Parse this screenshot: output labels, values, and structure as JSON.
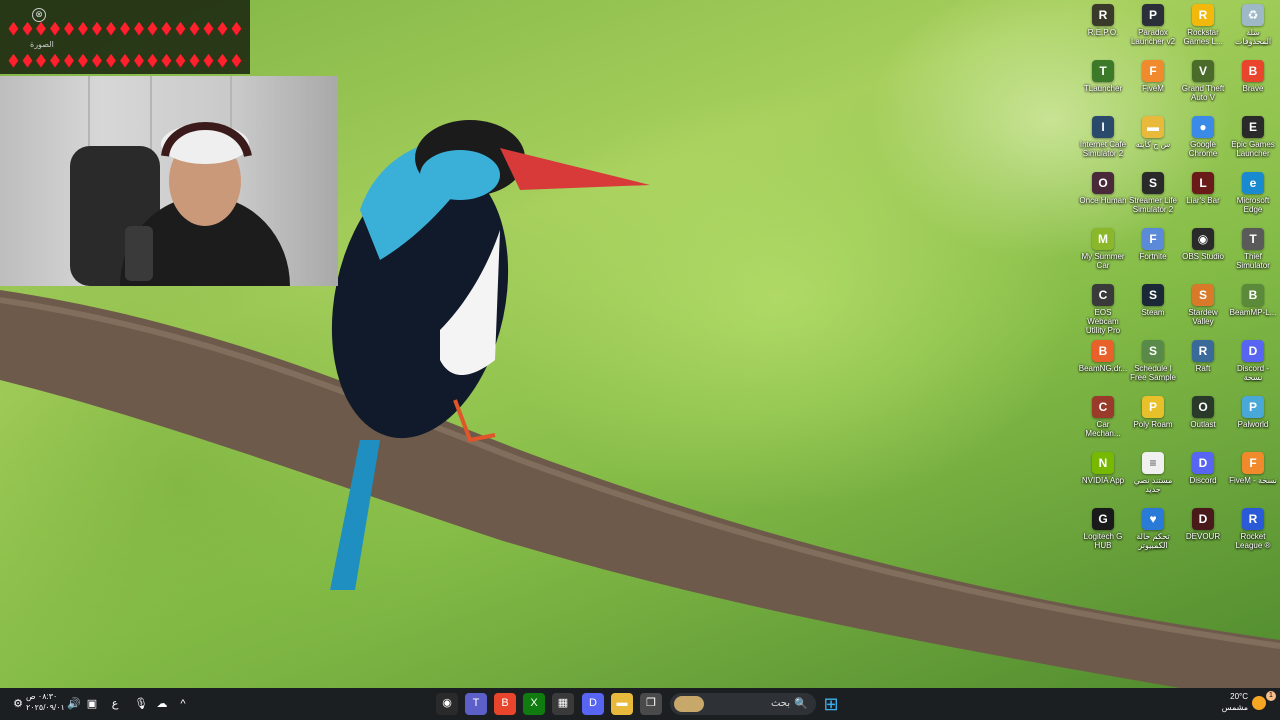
{
  "overlay": {
    "close_glyph": "⊗",
    "line1": "♦️♦️♦️♦️♦️♦️♦️♦️♦️♦️♦️♦️♦️♦️♦️♦️♦️♦️♦️♦️",
    "line2": "♦️♦️♦️♦️♦️♦️♦️♦️♦️♦️♦️♦️♦️♦️♦️♦️♦️♦️♦️♦️",
    "caption": "الصورة",
    "line3": "♦️♦️♦️♦️♦️♦️♦️♦️♦️♦️♦️♦️♦️♦️♦️♦️♦️♦️♦️♦️"
  },
  "desktop_icons": [
    {
      "label": "R.E.P.O.",
      "icon": "repo-icon",
      "color": "#3a3a2a",
      "glyph": "R"
    },
    {
      "label": "Paradox Launcher v2",
      "icon": "paradox-icon",
      "color": "#2a2f3a",
      "glyph": "P"
    },
    {
      "label": "Rockstar Games L...",
      "icon": "rockstar-icon",
      "color": "#f2b90c",
      "glyph": "R"
    },
    {
      "label": "سلة المحذوفات",
      "icon": "recycle-bin-icon",
      "color": "#9fb8c8",
      "glyph": "♻"
    },
    {
      "label": "TLauncher",
      "icon": "tlauncher-icon",
      "color": "#3c7a2a",
      "glyph": "T"
    },
    {
      "label": "FiveM",
      "icon": "fivem-icon",
      "color": "#f08a2c",
      "glyph": "F"
    },
    {
      "label": "Grand Theft Auto V",
      "icon": "gta-icon",
      "color": "#4a6b2a",
      "glyph": "V"
    },
    {
      "label": "Brave",
      "icon": "brave-icon",
      "color": "#e8452c",
      "glyph": "B"
    },
    {
      "label": "Internet Cafe Simulator 2",
      "icon": "internet-cafe-icon",
      "color": "#2b4a6b",
      "glyph": "I"
    },
    {
      "label": "س ح كايته",
      "icon": "folder-icon",
      "color": "#e8b93a",
      "glyph": "▬"
    },
    {
      "label": "Google Chrome",
      "icon": "chrome-icon",
      "color": "#3c8ae8",
      "glyph": "●"
    },
    {
      "label": "Epic Games Launcher",
      "icon": "epic-games-icon",
      "color": "#2a2a2a",
      "glyph": "E"
    },
    {
      "label": "Once Human",
      "icon": "once-human-icon",
      "color": "#4a2a3a",
      "glyph": "O"
    },
    {
      "label": "Streamer Life Simulator 2",
      "icon": "streamer-life-icon",
      "color": "#2a2a2a",
      "glyph": "S"
    },
    {
      "label": "Liar's Bar",
      "icon": "liars-bar-icon",
      "color": "#6b1a1a",
      "glyph": "L"
    },
    {
      "label": "Microsoft Edge",
      "icon": "edge-icon",
      "color": "#1a8ad0",
      "glyph": "e"
    },
    {
      "label": "My Summer Car",
      "icon": "my-summer-car-icon",
      "color": "#8ab82a",
      "glyph": "M"
    },
    {
      "label": "Fortnite",
      "icon": "fortnite-icon",
      "color": "#5a8ad8",
      "glyph": "F"
    },
    {
      "label": "OBS Studio",
      "icon": "obs-icon",
      "color": "#2a2a2a",
      "glyph": "◉"
    },
    {
      "label": "Thief Simulator",
      "icon": "thief-sim-icon",
      "color": "#5a5a5a",
      "glyph": "T"
    },
    {
      "label": "EOS Webcam Utility Pro",
      "icon": "eos-webcam-icon",
      "color": "#3a3a3a",
      "glyph": "C"
    },
    {
      "label": "Steam",
      "icon": "steam-icon",
      "color": "#1b2838",
      "glyph": "S"
    },
    {
      "label": "Stardew Valley",
      "icon": "stardew-icon",
      "color": "#d87a2a",
      "glyph": "S"
    },
    {
      "label": "BeamMP-L...",
      "icon": "beammp-icon",
      "color": "#5a8a3a",
      "glyph": "B"
    },
    {
      "label": "BeamNG.dr...",
      "icon": "beamng-icon",
      "color": "#e8602a",
      "glyph": "B"
    },
    {
      "label": "Schedule I Free Sample",
      "icon": "schedule-i-icon",
      "color": "#5a8a4a",
      "glyph": "S"
    },
    {
      "label": "Raft",
      "icon": "raft-icon",
      "color": "#3a6a9a",
      "glyph": "R"
    },
    {
      "label": "Discord - نسخة",
      "icon": "discord-icon",
      "color": "#5865f2",
      "glyph": "D"
    },
    {
      "label": "Car Mechan...",
      "icon": "car-mechanic-icon",
      "color": "#9a3a2a",
      "glyph": "C"
    },
    {
      "label": "Poly Roam",
      "icon": "poly-roam-icon",
      "color": "#e8c02a",
      "glyph": "P"
    },
    {
      "label": "Outlast",
      "icon": "outlast-icon",
      "color": "#2a3a2a",
      "glyph": "O"
    },
    {
      "label": "Palworld",
      "icon": "palworld-icon",
      "color": "#4aa8d8",
      "glyph": "P"
    },
    {
      "label": "NVIDIA App",
      "icon": "nvidia-icon",
      "color": "#76b900",
      "glyph": "N"
    },
    {
      "label": "مستند نصي جديد",
      "icon": "text-document-icon",
      "color": "#f0f0f0",
      "glyph": "≡"
    },
    {
      "label": "Discord",
      "icon": "discord-icon",
      "color": "#5865f2",
      "glyph": "D"
    },
    {
      "label": "FiveM - نسخة",
      "icon": "fivem-icon",
      "color": "#f08a2c",
      "glyph": "F"
    },
    {
      "label": "Logitech G HUB",
      "icon": "logitech-icon",
      "color": "#1a1a1a",
      "glyph": "G"
    },
    {
      "label": "تحكم حالة الكمبيوتر",
      "icon": "pc-health-icon",
      "color": "#2a7ad8",
      "glyph": "♥"
    },
    {
      "label": "DEVOUR",
      "icon": "devour-icon",
      "color": "#4a1a1a",
      "glyph": "D"
    },
    {
      "label": "Rocket League ®",
      "icon": "rocket-league-icon",
      "color": "#2a5ad8",
      "glyph": "R"
    }
  ],
  "taskbar": {
    "clock_time": "٠٨:٣٠ ص",
    "clock_date": "٢٠٢٥/٠٩/٠١",
    "lang": "ع",
    "search_label": "بحث",
    "search_glyph": "🔍",
    "start_glyph": "⊞",
    "chevron_glyph": "^",
    "weather_temp": "20°C",
    "weather_desc": "مشمس",
    "notification_badge": "1",
    "apps": [
      {
        "name": "obs-taskbar-icon",
        "glyph": "◉",
        "color": "#2a2a2a"
      },
      {
        "name": "teams-taskbar-icon",
        "glyph": "T",
        "color": "#5b5fc7"
      },
      {
        "name": "brave-taskbar-icon",
        "glyph": "B",
        "color": "#e8452c"
      },
      {
        "name": "xbox-taskbar-icon",
        "glyph": "X",
        "color": "#107c10"
      },
      {
        "name": "store-taskbar-icon",
        "glyph": "▦",
        "color": "#3a3a3a"
      },
      {
        "name": "discord-taskbar-icon",
        "glyph": "D",
        "color": "#5865f2"
      },
      {
        "name": "file-explorer-taskbar-icon",
        "glyph": "▬",
        "color": "#e8b93a"
      },
      {
        "name": "task-view-taskbar-icon",
        "glyph": "❐",
        "color": "#4a4a4a"
      }
    ]
  }
}
